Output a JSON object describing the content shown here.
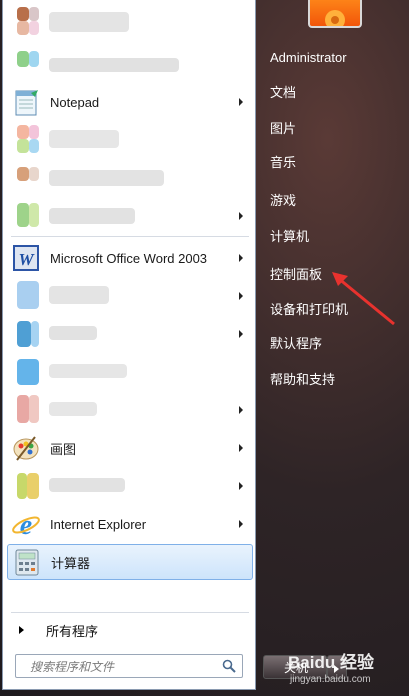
{
  "programs": {
    "notepad": "Notepad",
    "word": "Microsoft Office Word 2003",
    "paint": "画图",
    "ie": "Internet Explorer",
    "calculator": "计算器"
  },
  "all_programs": "所有程序",
  "search": {
    "placeholder": "搜索程序和文件"
  },
  "right_menu": {
    "user": "Administrator",
    "documents": "文档",
    "pictures": "图片",
    "music": "音乐",
    "games": "游戏",
    "computer": "计算机",
    "control_panel": "控制面板",
    "devices_printers": "设备和打印机",
    "default_programs": "默认程序",
    "help_support": "帮助和支持"
  },
  "shutdown": {
    "label": "关机"
  },
  "watermark": {
    "brand": "Baidu 经验",
    "url": "jingyan.baidu.com"
  },
  "colors": {
    "highlight": "#cde4fb",
    "arrow": "#e8322e"
  }
}
